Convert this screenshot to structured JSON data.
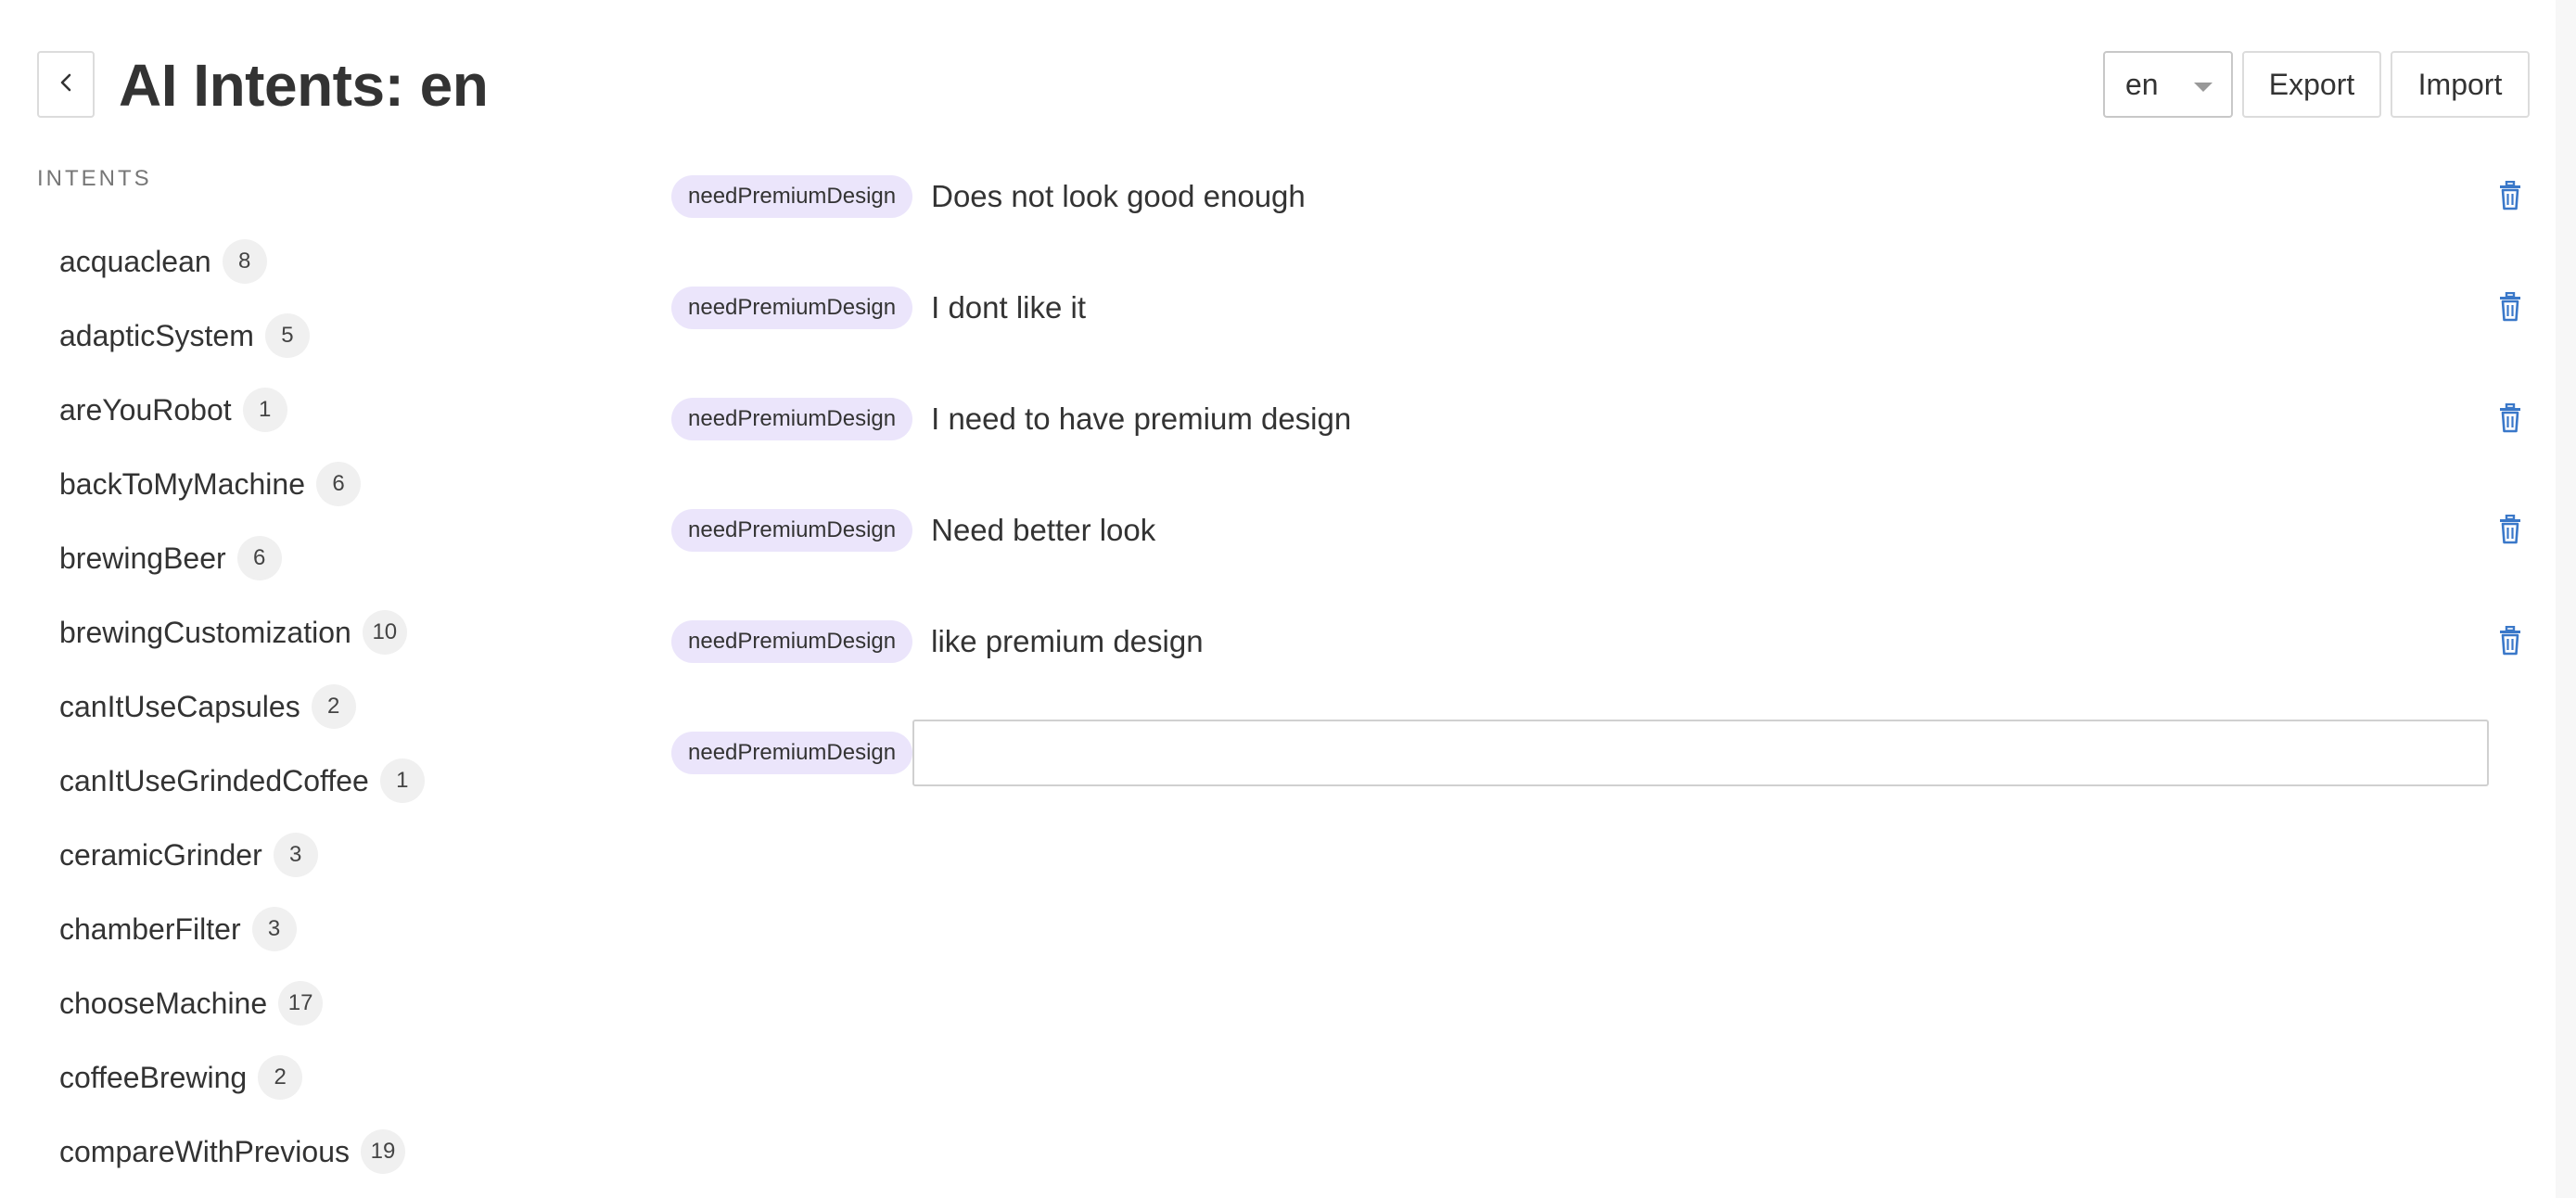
{
  "header": {
    "title": "AI Intents: en",
    "language_value": "en",
    "export_label": "Export",
    "import_label": "Import"
  },
  "sidebar": {
    "heading": "INTENTS",
    "items": [
      {
        "name": "acquaclean",
        "count": "8"
      },
      {
        "name": "adapticSystem",
        "count": "5"
      },
      {
        "name": "areYouRobot",
        "count": "1"
      },
      {
        "name": "backToMyMachine",
        "count": "6"
      },
      {
        "name": "brewingBeer",
        "count": "6"
      },
      {
        "name": "brewingCustomization",
        "count": "10"
      },
      {
        "name": "canItUseCapsules",
        "count": "2"
      },
      {
        "name": "canItUseGrindedCoffee",
        "count": "1"
      },
      {
        "name": "ceramicGrinder",
        "count": "3"
      },
      {
        "name": "chamberFilter",
        "count": "3"
      },
      {
        "name": "chooseMachine",
        "count": "17"
      },
      {
        "name": "coffeeBrewing",
        "count": "2"
      },
      {
        "name": "compareWithPrevious",
        "count": "19"
      }
    ]
  },
  "examples": {
    "items": [
      {
        "intent": "needPremiumDesign",
        "text": "Does not look good enough"
      },
      {
        "intent": "needPremiumDesign",
        "text": "I dont like it"
      },
      {
        "intent": "needPremiumDesign",
        "text": "I need to have premium design"
      },
      {
        "intent": "needPremiumDesign",
        "text": "Need better look"
      },
      {
        "intent": "needPremiumDesign",
        "text": "like premium design"
      }
    ],
    "new_item": {
      "intent": "needPremiumDesign",
      "value": "",
      "placeholder": ""
    }
  },
  "colors": {
    "tag_background": "#ebe5fb",
    "delete_icon": "#3a78c9",
    "count_badge": "#f0f0f0"
  },
  "icons": {
    "back": "chevron-left-icon",
    "dropdown": "caret-down-icon",
    "delete": "trash-icon"
  }
}
